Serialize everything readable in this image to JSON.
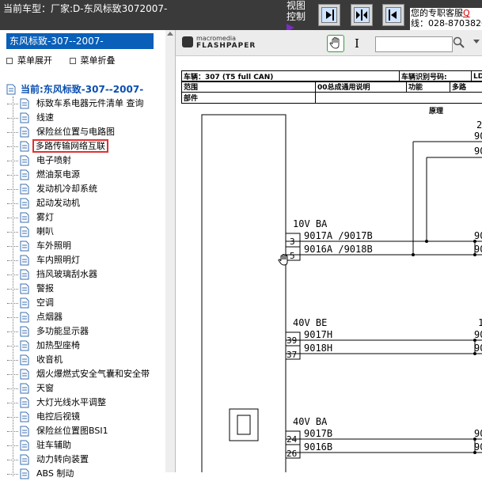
{
  "header": {
    "title": "当前车型：厂家:D-东风标致3072007-",
    "view_control_line1": "视图",
    "view_control_line2": "控制",
    "service_line1_a": "您的专职客服",
    "service_line1_b": "Q",
    "service_line2": "线：028-8703826"
  },
  "left": {
    "panel_title": "东风标致-307--2007-",
    "expand_label": "菜单展开",
    "collapse_label": "菜单折叠",
    "root_label": "当前:东风标致-307--2007-",
    "items": [
      "标致车系电器元件清单 查询",
      "线速",
      "保险丝位置与电路图",
      "多路传输网络互联",
      "电子喷射",
      "燃油泵电源",
      "发动机冷却系统",
      "起动发动机",
      "雾灯",
      "喇叭",
      "车外照明",
      "车内照明灯",
      "挡风玻璃刮水器",
      "警报",
      "空调",
      "点烟器",
      "多功能显示器",
      "加热型座椅",
      "收音机",
      "烟火爆燃式安全气囊和安全带",
      "天窗",
      "大灯光线水平调整",
      "电控后视镜",
      "保险丝位置图BSI1",
      "驻车辅助",
      "动力转向装置",
      "ABS 制动"
    ],
    "selected_index": 3
  },
  "flashpaper": {
    "brand_line1": "macromedia",
    "brand_line2": "FLASHPAPER",
    "search_value": ""
  },
  "document": {
    "row1_col1": "车辆：307 (T5 full CAN)",
    "row1_col2": "车辆识别号码:",
    "row1_col3": "LDC",
    "row2_col1": "范围",
    "row2_col2": "00总成通用说明",
    "row2_col3": "功能",
    "row2_col4": "多路",
    "row3_col1": "部件",
    "principle_label": "原理",
    "wires": {
      "g1_label": "10V  BA",
      "g1_w1": "9017A /9017B",
      "g1_w2": "9016A /9018B",
      "g1_p1": "3",
      "g1_p2": "5",
      "g2_label": "40V  BE",
      "g2_w1": "9017H",
      "g2_w2": "9018H",
      "g2_p1": "39",
      "g2_p2": "37",
      "g3_label": "40V  BA",
      "g3_w1": "9017B",
      "g3_w2": "9016B",
      "g3_p1": "24",
      "g3_p2": "26",
      "right_a": "2",
      "right_b": "90",
      "right_c": "90",
      "right_d": "90",
      "right_e": "90",
      "right_f": "1",
      "right_g": "90",
      "right_h": "90",
      "right_i": "90",
      "right_j": "90"
    }
  }
}
